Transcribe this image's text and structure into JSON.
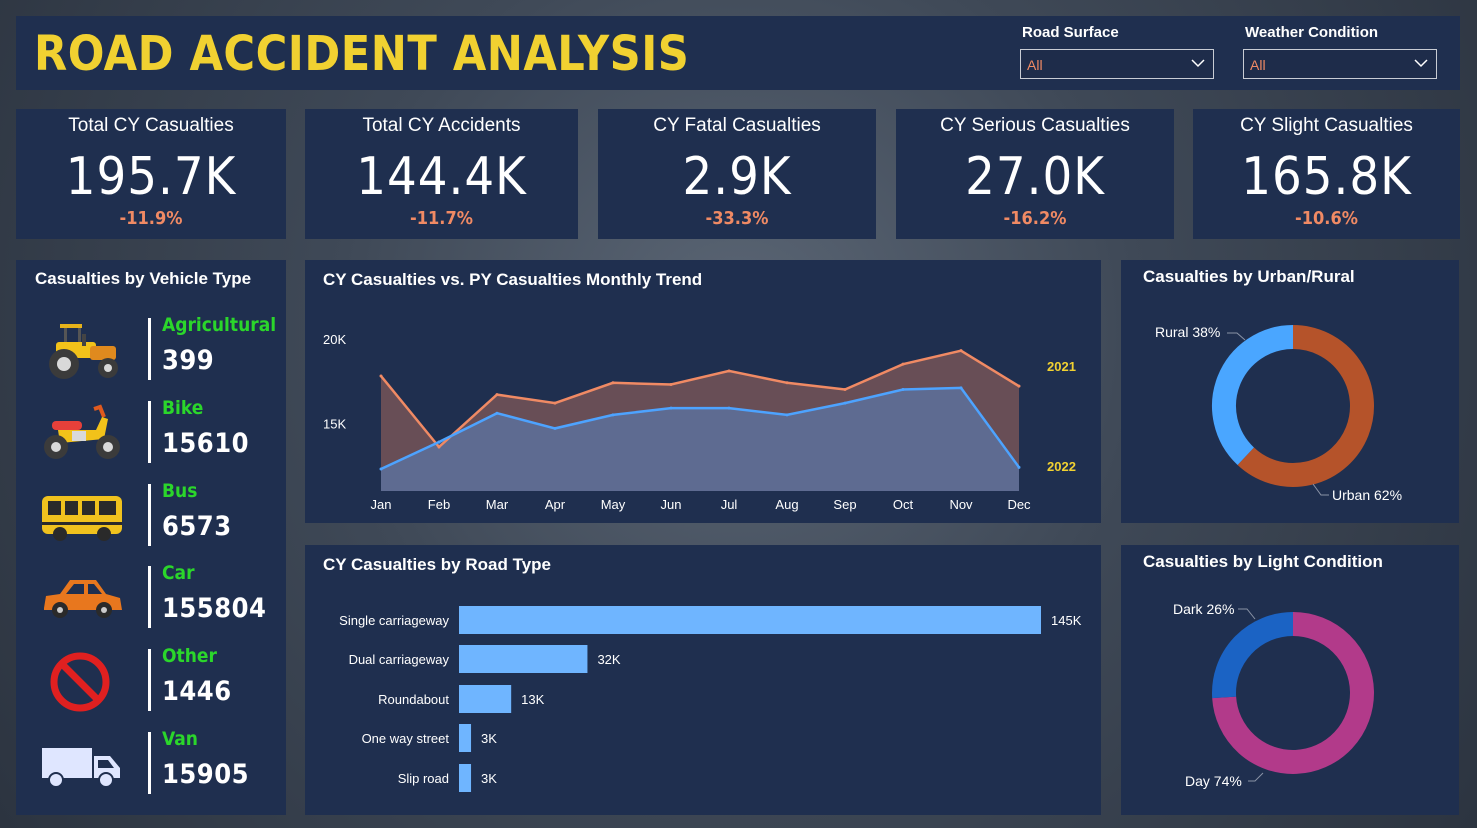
{
  "header": {
    "title": "ROAD ACCIDENT ANALYSIS"
  },
  "filters": [
    {
      "label": "Road Surface",
      "value": "All"
    },
    {
      "label": "Weather Condition",
      "value": "All"
    }
  ],
  "kpis": [
    {
      "title": "Total CY Casualties",
      "value": "195.7K",
      "change": "-11.9%"
    },
    {
      "title": "Total CY Accidents",
      "value": "144.4K",
      "change": "-11.7%"
    },
    {
      "title": "CY Fatal Casualties",
      "value": "2.9K",
      "change": "-33.3%"
    },
    {
      "title": "CY Serious Casualties",
      "value": "27.0K",
      "change": "-16.2%"
    },
    {
      "title": "CY Slight Casualties",
      "value": "165.8K",
      "change": "-10.6%"
    }
  ],
  "vehicles": {
    "title": "Casualties by Vehicle Type",
    "items": [
      {
        "name": "Agricultural",
        "value": "399",
        "icon": "tractor-icon"
      },
      {
        "name": "Bike",
        "value": "15610",
        "icon": "motorbike-icon"
      },
      {
        "name": "Bus",
        "value": "6573",
        "icon": "bus-icon"
      },
      {
        "name": "Car",
        "value": "155804",
        "icon": "car-icon"
      },
      {
        "name": "Other",
        "value": "1446",
        "icon": "prohibited-icon"
      },
      {
        "name": "Van",
        "value": "15905",
        "icon": "van-icon"
      }
    ]
  },
  "colors": {
    "accent_yellow": "#f1d131",
    "delta_orange": "#f08a64",
    "vehicle_green": "#2bd62b",
    "py_line": "#f08a64",
    "cy_line": "#4da3ff",
    "bar_blue": "#6fb5ff",
    "urban": "#b5532a",
    "rural": "#4aa6ff",
    "day": "#b23a8a",
    "dark": "#1b63c4"
  },
  "chart_data": [
    {
      "type": "area",
      "title": "CY Casualties vs. PY Casualties Monthly Trend",
      "categories": [
        "Jan",
        "Feb",
        "Mar",
        "Apr",
        "May",
        "Jun",
        "Jul",
        "Aug",
        "Sep",
        "Oct",
        "Nov",
        "Dec"
      ],
      "yticks": [
        "15K",
        "20K"
      ],
      "ylim": [
        11000,
        22000
      ],
      "series": [
        {
          "name": "2021",
          "values": [
            17800,
            13600,
            16700,
            16200,
            17400,
            17300,
            18100,
            17400,
            17000,
            18500,
            19300,
            17200
          ]
        },
        {
          "name": "2022",
          "values": [
            12300,
            13900,
            15600,
            14700,
            15500,
            15900,
            15900,
            15500,
            16200,
            17000,
            17100,
            12400
          ]
        }
      ]
    },
    {
      "type": "bar",
      "title": "CY Casualties by Road Type",
      "categories": [
        "Single carriageway",
        "Dual carriageway",
        "Roundabout",
        "One way street",
        "Slip road"
      ],
      "values": [
        145,
        32,
        13,
        3,
        3
      ],
      "labels": [
        "145K",
        "32K",
        "13K",
        "3K",
        "3K"
      ],
      "xlim": [
        0,
        145
      ]
    },
    {
      "type": "pie",
      "title": "Casualties by Urban/Rural",
      "slices": [
        {
          "name": "Urban",
          "value": 62,
          "label": "Urban 62%"
        },
        {
          "name": "Rural",
          "value": 38,
          "label": "Rural 38%"
        }
      ]
    },
    {
      "type": "pie",
      "title": "Casualties by Light Condition",
      "slices": [
        {
          "name": "Day",
          "value": 74,
          "label": "Day 74%"
        },
        {
          "name": "Dark",
          "value": 26,
          "label": "Dark 26%"
        }
      ]
    }
  ]
}
